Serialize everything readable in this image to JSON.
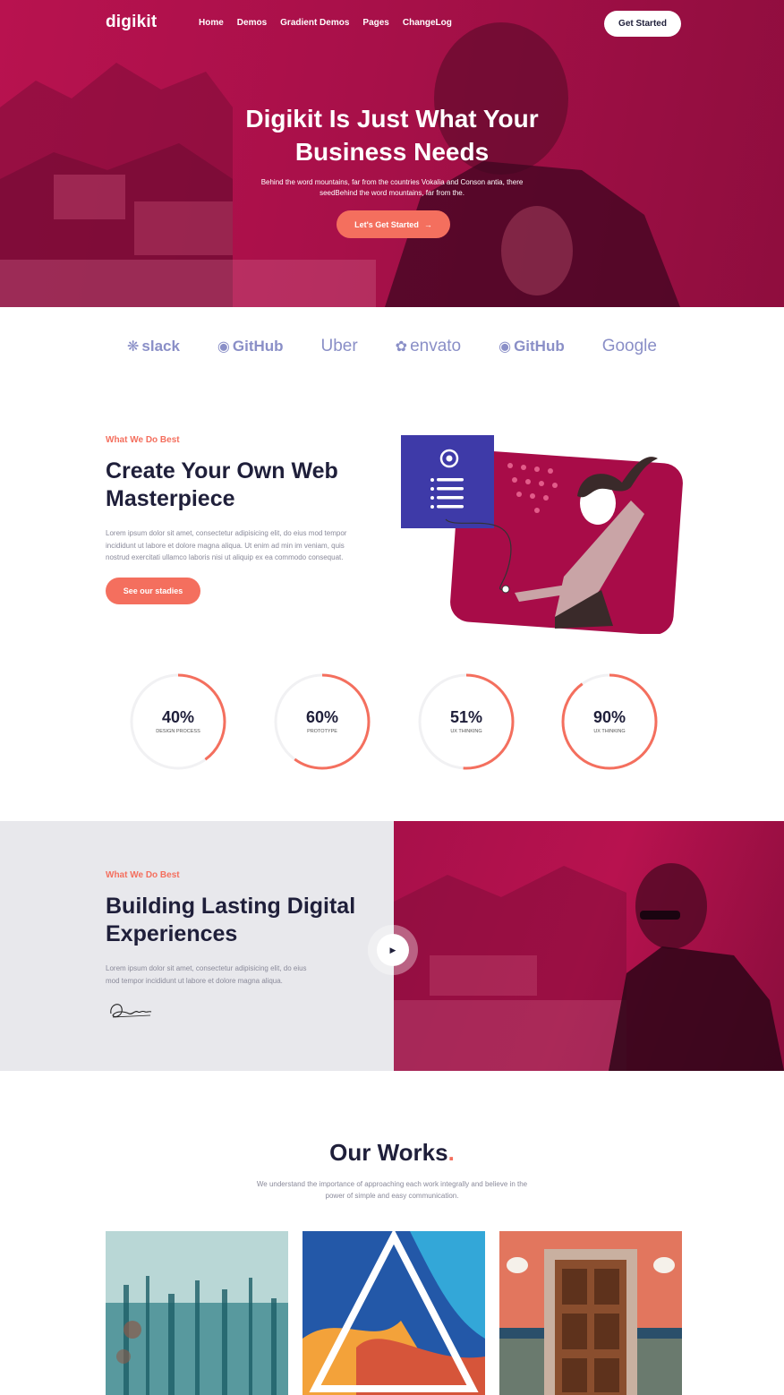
{
  "nav": {
    "logo": "digikit",
    "links": [
      "Home",
      "Demos",
      "Gradient Demos",
      "Pages",
      "ChangeLog"
    ],
    "cta": "Get Started"
  },
  "hero": {
    "title_line1": "Digikit Is Just What Your",
    "title_line2": "Business Needs",
    "subtitle_line1": "Behind the word mountains, far from the countries Vokalia and Conson antia, there",
    "subtitle_line2": "seedBehind the word mountains, far from the.",
    "button": "Let's Get Started",
    "button_icon": "arrow-right-icon"
  },
  "brands": [
    {
      "name": "slack",
      "icon": "slack-icon"
    },
    {
      "name": "GitHub",
      "icon": "github-icon"
    },
    {
      "name": "Uber",
      "icon": ""
    },
    {
      "name": "envato",
      "icon": "envato-leaf-icon"
    },
    {
      "name": "GitHub",
      "icon": "github-icon"
    },
    {
      "name": "Google",
      "icon": ""
    }
  ],
  "section1": {
    "eyebrow": "What We Do Best",
    "title_line1": "Create Your Own Web",
    "title_line2": "Masterpiece",
    "para_line1": "Lorem ipsum dolor sit amet, consectetur adipisicing elit, do eius mod tempor",
    "para_line2": "incididunt ut labore et dolore magna aliqua. Ut enim ad min im veniam, quis",
    "para_line3": "nostrud exercitati ullamco laboris nisi ut aliquip ex ea commodo consequat.",
    "button": "See our stadies"
  },
  "stats": [
    {
      "value": "40%",
      "label": "DESIGN PROCESS",
      "fraction": 0.4
    },
    {
      "value": "60%",
      "label": "PROTOTYPE",
      "fraction": 0.6
    },
    {
      "value": "51%",
      "label": "UX THINKING",
      "fraction": 0.51
    },
    {
      "value": "90%",
      "label": "UX THINKING",
      "fraction": 0.9
    }
  ],
  "section2": {
    "eyebrow": "What We Do Best",
    "title_line1": "Building Lasting Digital",
    "title_line2": "Experiences",
    "para_line1": "Lorem ipsum dolor sit amet, consectetur adipisicing elit, do eius",
    "para_line2": "mod tempor incididunt ut labore et dolore magna aliqua.",
    "signature": "signature-image",
    "play_icon": "play-icon"
  },
  "works": {
    "title": "Our Works",
    "title_dot": ".",
    "sub_line1": "We understand the importance of approaching each work integrally and believe in the",
    "sub_line2": "power of simple and easy communication."
  },
  "colors": {
    "primary": "#b8124f",
    "accent": "#f46f5e",
    "dark": "#1f1f3a",
    "brand_logo": "#8a8fc7",
    "panel_gray": "#e8e8ec"
  }
}
